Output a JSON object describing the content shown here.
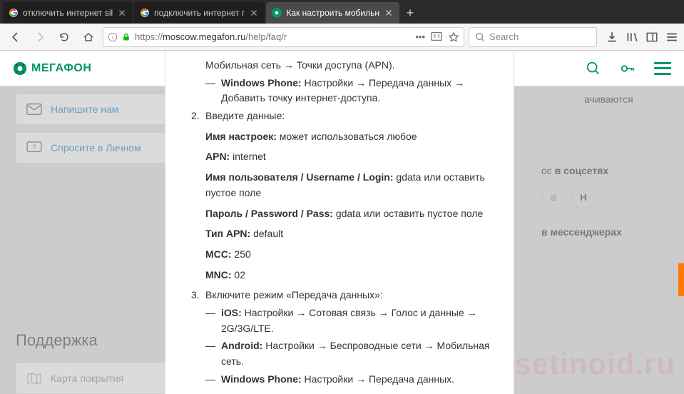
{
  "tabs": [
    {
      "title": "отключить интернет sil",
      "favicon": "google"
    },
    {
      "title": "подключить интернет г",
      "favicon": "google"
    },
    {
      "title": "Как настроить мобильн",
      "favicon": "megafon",
      "active": true
    }
  ],
  "url": {
    "prefix": "https://",
    "host": "moscow.megafon.ru",
    "path": "/help/faq/r"
  },
  "search_placeholder": "Search",
  "logo_text": "МЕГАФОН",
  "help": {
    "write": "Напишите нам",
    "ask": "Спросите в Личном"
  },
  "right": {
    "social_title_plain": "ос ",
    "social_title_bold": "в соцсетях",
    "mess_title": "в мессенджерах",
    "icons": [
      "☺",
      "Н"
    ]
  },
  "support": {
    "title": "Поддержка",
    "card": "Карта покрытия"
  },
  "watermark": "setinoid.ru",
  "modal": {
    "intro_remnant": "Мобильная сеть → Точки доступа (APN).",
    "wp_intro": {
      "label": "Windows Phone:",
      "text": " Настройки → Передача данных → Добавить точку интернет-доступа."
    },
    "step2": "Введите данные:",
    "fields": [
      {
        "label": "Имя настроек:",
        "value": " может использоваться любое"
      },
      {
        "label": "APN:",
        "value": " internet"
      },
      {
        "label": "Имя пользователя / Username / Login:",
        "value": " gdata или оставить пустое поле"
      },
      {
        "label": "Пароль / Password / Pass:",
        "value": " gdata или оставить пустое поле"
      },
      {
        "label": "Тип APN:",
        "value": " default"
      },
      {
        "label": "MCC:",
        "value": " 250"
      },
      {
        "label": "MNC:",
        "value": " 02"
      }
    ],
    "step3": "Включите режим «Передача данных»:",
    "step3_items": [
      {
        "label": "iOS:",
        "text": " Настройки → Сотовая связь → Голос и данные → 2G/3G/LTE."
      },
      {
        "label": "Android:",
        "text": " Настройки → Беспроводные сети → Мобильная сеть."
      },
      {
        "label": "Windows Phone:",
        "text": " Настройки → Передача данных."
      }
    ],
    "page_cut": "ачиваются"
  }
}
